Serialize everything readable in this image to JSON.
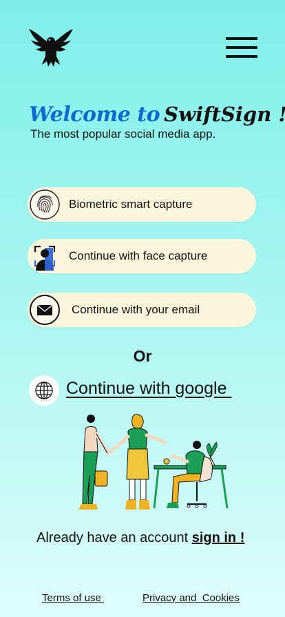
{
  "header": {
    "logo_icon": "eagle-logo-icon",
    "menu_icon": "hamburger-menu-icon"
  },
  "hero": {
    "title_welcome": "Welcome to",
    "title_brand": "SwiftSign !",
    "subtitle": "The most popular social media app."
  },
  "options": [
    {
      "label": "Biometric smart capture",
      "icon": "fingerprint-icon"
    },
    {
      "label": "Continue with face capture",
      "icon": "face-scan-icon"
    },
    {
      "label": "Continue with your email",
      "icon": "envelope-icon"
    }
  ],
  "divider_text": "Or",
  "google": {
    "label": "Continue with google ",
    "icon": "globe-icon"
  },
  "illustration": "people-meeting-illustration",
  "signin": {
    "prompt": "Already have an account ",
    "link": "sign in !"
  },
  "footer": {
    "terms": "Terms of use ",
    "privacy": "Privacy and  Cookies"
  },
  "colors": {
    "background_top": "#7fefe8",
    "pill_bg": "#fdf6dc",
    "brand_blue": "#0d6bd0"
  }
}
